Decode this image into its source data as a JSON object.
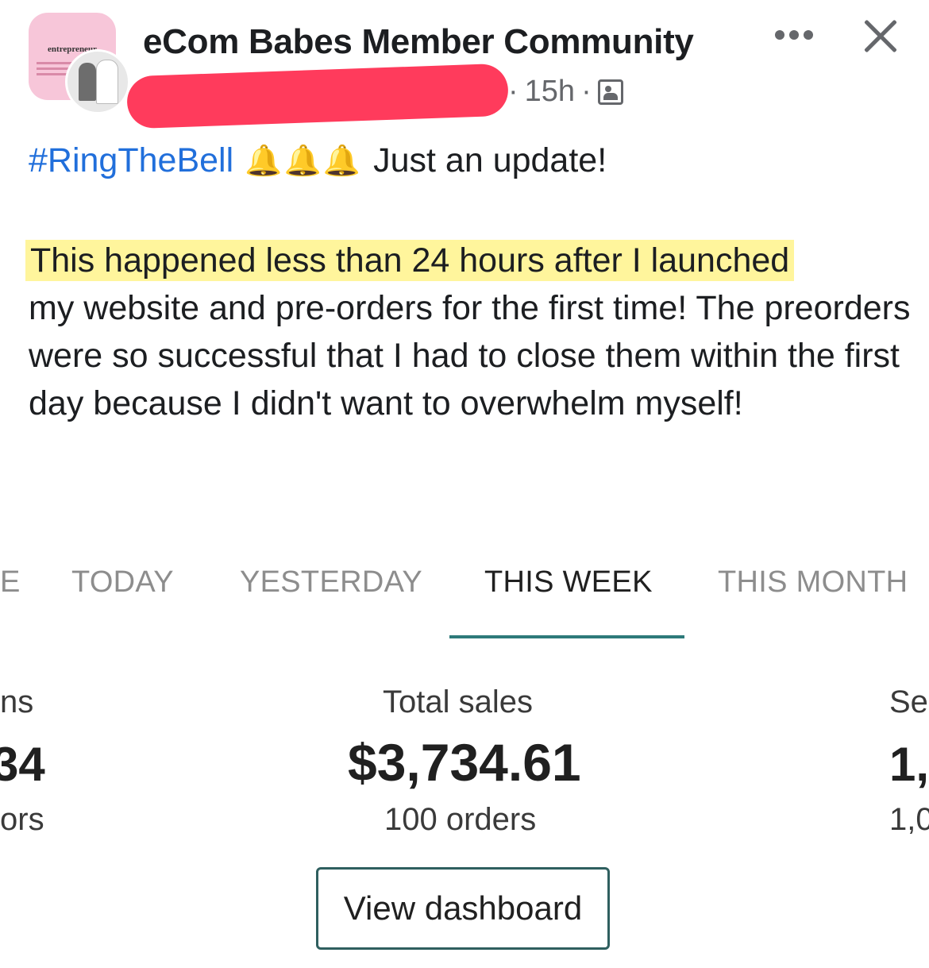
{
  "header": {
    "group_name": "eCom Babes Member Community",
    "time": "15h",
    "avatar_text": "entrepreneur",
    "more_icon": "more-dots-icon",
    "close_icon": "close-icon",
    "privacy_icon": "group-members-icon"
  },
  "post": {
    "hashtag": "#RingTheBell",
    "bells": "🔔🔔🔔",
    "intro": "Just an update!",
    "highlighted": "This happened less than 24 hours after I launched",
    "body": "my website and pre-orders for the first time! The preorders were so successful that I had to close them within the  first day because I didn't want to overwhelm myself!"
  },
  "dashboard": {
    "tabs": [
      {
        "label": "TODAY",
        "active": false
      },
      {
        "label": "YESTERDAY",
        "active": false
      },
      {
        "label": "THIS WEEK",
        "active": true
      },
      {
        "label": "THIS MONTH",
        "active": false
      }
    ],
    "left_partial": {
      "label": "ns",
      "value": "34",
      "sub": "ors"
    },
    "center": {
      "label": "Total sales",
      "value": "$3,734.61",
      "sub": "100 orders"
    },
    "right_partial": {
      "label": "Se",
      "value": "1,",
      "sub": "1,0"
    },
    "button_label": "View dashboard",
    "accent_color": "#2d7a7a"
  }
}
